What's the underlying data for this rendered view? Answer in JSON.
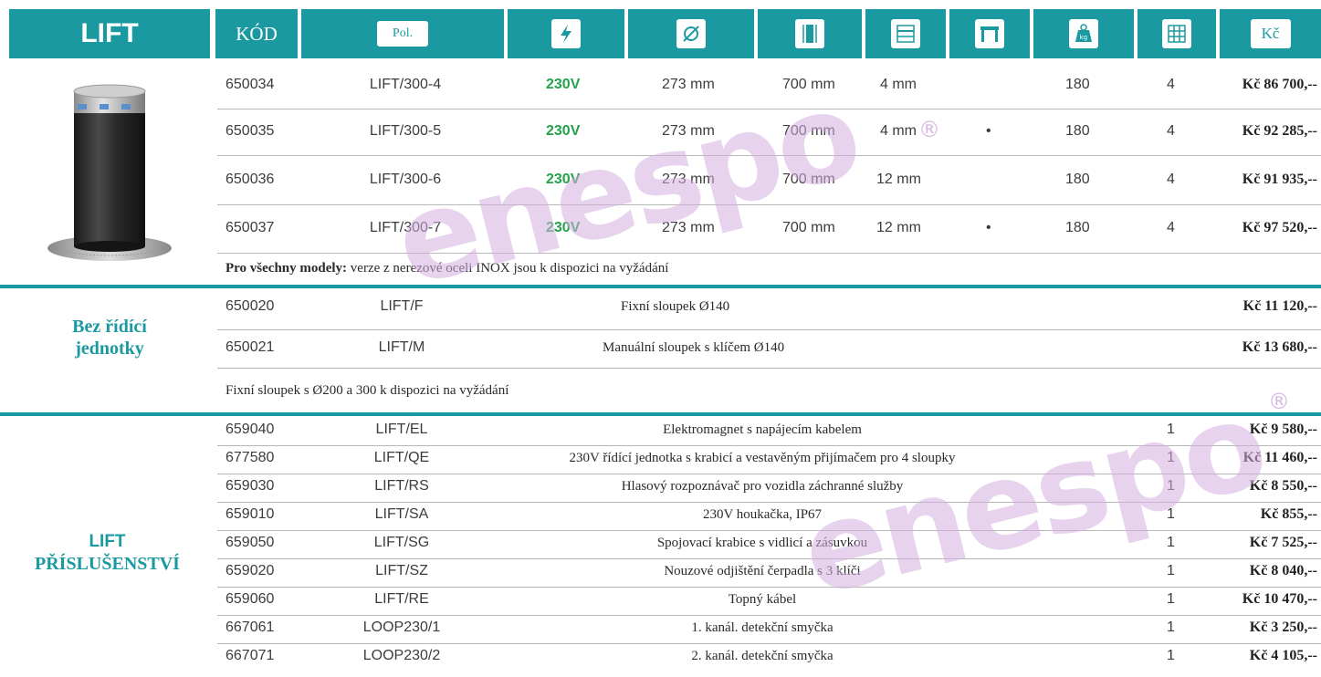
{
  "header": {
    "title": "LIFT",
    "kod_label": "KÓD",
    "pol_label": "Pol.",
    "currency_label": "Kč",
    "icons": [
      "power-icon",
      "diameter-icon",
      "height-icon",
      "thickness-icon",
      "inox-icon",
      "weight-icon",
      "grid-icon"
    ]
  },
  "models": [
    {
      "code": "650034",
      "pol": "LIFT/300-4",
      "voltage": "230V",
      "diameter": "273 mm",
      "height": "700 mm",
      "thickness": "4 mm",
      "inox": "",
      "weight": "180",
      "qty": "4",
      "price": "Kč  86 700,--"
    },
    {
      "code": "650035",
      "pol": "LIFT/300-5",
      "voltage": "230V",
      "diameter": "273 mm",
      "height": "700 mm",
      "thickness": "4 mm",
      "inox": "•",
      "weight": "180",
      "qty": "4",
      "price": "Kč  92 285,--"
    },
    {
      "code": "650036",
      "pol": "LIFT/300-6",
      "voltage": "230V",
      "diameter": "273 mm",
      "height": "700 mm",
      "thickness": "12 mm",
      "inox": "",
      "weight": "180",
      "qty": "4",
      "price": "Kč  91 935,--"
    },
    {
      "code": "650037",
      "pol": "LIFT/300-7",
      "voltage": "230V",
      "diameter": "273 mm",
      "height": "700 mm",
      "thickness": "12 mm",
      "inox": "•",
      "weight": "180",
      "qty": "4",
      "price": "Kč  97 520,--"
    }
  ],
  "models_note_bold": "Pro všechny modely:",
  "models_note_rest": " verze z nerezové oceli INOX  jsou k dispozici na vyžádání",
  "section2": {
    "title_line1": "Bez řídící",
    "title_line2": "jednotky",
    "rows": [
      {
        "code": "650020",
        "pol": "LIFT/F",
        "desc": "Fixní sloupek Ø140",
        "price": "Kč  11 120,--"
      },
      {
        "code": "650021",
        "pol": "LIFT/M",
        "desc": "Manuální sloupek s klíčem Ø140",
        "price": "Kč  13 680,--"
      }
    ],
    "note": "Fixní sloupek s Ø200 a 300 k dispozici na vyžádání"
  },
  "section3": {
    "title_line1": "LIFT",
    "title_line2": "PŘÍSLUŠENSTVÍ",
    "rows": [
      {
        "code": "659040",
        "pol": "LIFT/EL",
        "desc": "Elektromagnet s napájecím kabelem",
        "qty": "1",
        "price": "Kč  9 580,--"
      },
      {
        "code": "677580",
        "pol": "LIFT/QE",
        "desc": "230V řídící jednotka s krabicí a vestavěným přijímačem pro  4 sloupky",
        "qty": "1",
        "price": "Kč  11 460,--"
      },
      {
        "code": "659030",
        "pol": "LIFT/RS",
        "desc": "Hlasový rozpoznávač pro vozidla záchranné služby",
        "qty": "1",
        "price": "Kč  8 550,--"
      },
      {
        "code": "659010",
        "pol": "LIFT/SA",
        "desc": "230V houkačka, IP67",
        "qty": "1",
        "price": "Kč  855,--"
      },
      {
        "code": "659050",
        "pol": "LIFT/SG",
        "desc": "Spojovací krabice s vidlicí a zásuvkou",
        "qty": "1",
        "price": "Kč  7 525,--"
      },
      {
        "code": "659020",
        "pol": "LIFT/SZ",
        "desc": "Nouzové odjištění čerpadla s 3 klíči",
        "qty": "1",
        "price": "Kč  8 040,--"
      },
      {
        "code": "659060",
        "pol": "LIFT/RE",
        "desc": "Topný kábel",
        "qty": "1",
        "price": "Kč  10 470,--"
      },
      {
        "code": "667061",
        "pol": "LOOP230/1",
        "desc": "1. kanál. detekční smyčka",
        "qty": "1",
        "price": "Kč  3 250,--"
      },
      {
        "code": "667071",
        "pol": "LOOP230/2",
        "desc": "2. kanál. detekční smyčka",
        "qty": "1",
        "price": "Kč  4 105,--"
      }
    ]
  },
  "watermark": {
    "text": "enespo",
    "mark": "®"
  },
  "colors": {
    "accent": "#1a9aa0",
    "voltage": "#22a24a",
    "watermark": "#d4afde"
  }
}
